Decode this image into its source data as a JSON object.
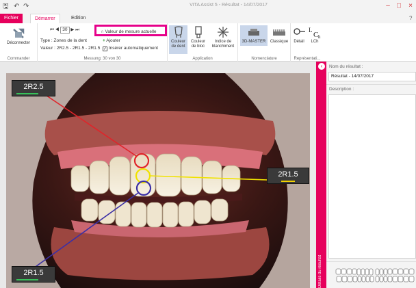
{
  "window": {
    "title": "VITA Assist 5 - Résultat - 14/07/2017",
    "minimize": "–",
    "maximize": "□",
    "close": "×",
    "help": "?"
  },
  "quick_access": {
    "save": "🖫",
    "undo": "↶",
    "redo": "↷"
  },
  "tabs": {
    "file": "Fichier",
    "start": "Démarrer",
    "edit": "Edition"
  },
  "ribbon": {
    "commander": {
      "disconnect": "Déconnecter",
      "group": "Commander"
    },
    "measurement": {
      "first": "⏮",
      "prev": "◀",
      "page": "30",
      "next": "▶",
      "last": "⏭",
      "type_label": "Type :",
      "type_value": "Zones de la dent",
      "valeur_label": "Valeur :",
      "valeur_value": "2R2.5 - 2R1.5 - 2R1.5",
      "current": "Valeur de mesure actuelle",
      "add": "Ajouter",
      "auto": "Insérer automatiquement",
      "group": "Messung: 30 von 30"
    },
    "application": {
      "tooth": "Couleur\nde dent",
      "block": "Couleur\nde bloc",
      "whitening": "Indice de\nblanchiment",
      "group": "Application"
    },
    "nomenclature": {
      "master": "3D-MASTER",
      "classic": "Classique",
      "group": "Nomenclature"
    },
    "representation": {
      "detail": "Détail",
      "lch": "LCh",
      "group": "Représentati..."
    }
  },
  "labels": {
    "top_left": "2R2.5",
    "right": "2R1.5",
    "bottom_left": "2R1.5"
  },
  "colors": {
    "accent": "#e6005c",
    "red": "#e0242a",
    "yellow": "#f0e200",
    "blue": "#3b2fa6",
    "green_bar": "#38c15a",
    "yellow_bar": "#f2d000"
  },
  "panel": {
    "collapse": "‹",
    "name_label": "Nom du résultat :",
    "name_value": "Résultat - 14/07/2017",
    "desc_label": "Description :",
    "vertical": "Détails du résultat"
  }
}
